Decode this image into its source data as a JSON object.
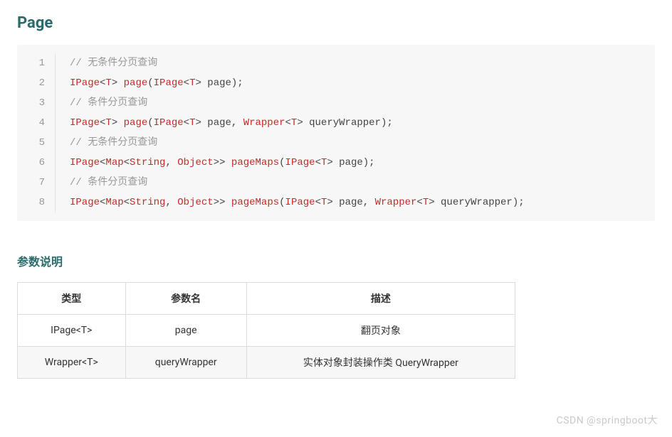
{
  "heading": "Page",
  "code": {
    "lines": [
      {
        "n": "1",
        "tokens": [
          {
            "t": "// 无条件分页查询",
            "c": "tok-comment"
          }
        ]
      },
      {
        "n": "2",
        "tokens": [
          {
            "t": "IPage",
            "c": "tok-type"
          },
          {
            "t": "<",
            "c": "tok-punc"
          },
          {
            "t": "T",
            "c": "tok-type"
          },
          {
            "t": "> ",
            "c": "tok-punc"
          },
          {
            "t": "page",
            "c": "tok-method"
          },
          {
            "t": "(",
            "c": "tok-punc"
          },
          {
            "t": "IPage",
            "c": "tok-type"
          },
          {
            "t": "<",
            "c": "tok-punc"
          },
          {
            "t": "T",
            "c": "tok-type"
          },
          {
            "t": "> page);",
            "c": "tok-param"
          }
        ]
      },
      {
        "n": "3",
        "tokens": [
          {
            "t": "// 条件分页查询",
            "c": "tok-comment"
          }
        ]
      },
      {
        "n": "4",
        "tokens": [
          {
            "t": "IPage",
            "c": "tok-type"
          },
          {
            "t": "<",
            "c": "tok-punc"
          },
          {
            "t": "T",
            "c": "tok-type"
          },
          {
            "t": "> ",
            "c": "tok-punc"
          },
          {
            "t": "page",
            "c": "tok-method"
          },
          {
            "t": "(",
            "c": "tok-punc"
          },
          {
            "t": "IPage",
            "c": "tok-type"
          },
          {
            "t": "<",
            "c": "tok-punc"
          },
          {
            "t": "T",
            "c": "tok-type"
          },
          {
            "t": "> page, ",
            "c": "tok-param"
          },
          {
            "t": "Wrapper",
            "c": "tok-type"
          },
          {
            "t": "<",
            "c": "tok-punc"
          },
          {
            "t": "T",
            "c": "tok-type"
          },
          {
            "t": "> queryWrapper);",
            "c": "tok-param"
          }
        ]
      },
      {
        "n": "5",
        "tokens": [
          {
            "t": "// 无条件分页查询",
            "c": "tok-comment"
          }
        ]
      },
      {
        "n": "6",
        "tokens": [
          {
            "t": "IPage",
            "c": "tok-type"
          },
          {
            "t": "<",
            "c": "tok-punc"
          },
          {
            "t": "Map",
            "c": "tok-type"
          },
          {
            "t": "<",
            "c": "tok-punc"
          },
          {
            "t": "String",
            "c": "tok-type"
          },
          {
            "t": ", ",
            "c": "tok-punc"
          },
          {
            "t": "Object",
            "c": "tok-type"
          },
          {
            "t": ">> ",
            "c": "tok-punc"
          },
          {
            "t": "pageMaps",
            "c": "tok-method"
          },
          {
            "t": "(",
            "c": "tok-punc"
          },
          {
            "t": "IPage",
            "c": "tok-type"
          },
          {
            "t": "<",
            "c": "tok-punc"
          },
          {
            "t": "T",
            "c": "tok-type"
          },
          {
            "t": "> page);",
            "c": "tok-param"
          }
        ]
      },
      {
        "n": "7",
        "tokens": [
          {
            "t": "// 条件分页查询",
            "c": "tok-comment"
          }
        ]
      },
      {
        "n": "8",
        "tokens": [
          {
            "t": "IPage",
            "c": "tok-type"
          },
          {
            "t": "<",
            "c": "tok-punc"
          },
          {
            "t": "Map",
            "c": "tok-type"
          },
          {
            "t": "<",
            "c": "tok-punc"
          },
          {
            "t": "String",
            "c": "tok-type"
          },
          {
            "t": ", ",
            "c": "tok-punc"
          },
          {
            "t": "Object",
            "c": "tok-type"
          },
          {
            "t": ">> ",
            "c": "tok-punc"
          },
          {
            "t": "pageMaps",
            "c": "tok-method"
          },
          {
            "t": "(",
            "c": "tok-punc"
          },
          {
            "t": "IPage",
            "c": "tok-type"
          },
          {
            "t": "<",
            "c": "tok-punc"
          },
          {
            "t": "T",
            "c": "tok-type"
          },
          {
            "t": "> page, ",
            "c": "tok-param"
          },
          {
            "t": "Wrapper",
            "c": "tok-type"
          },
          {
            "t": "<",
            "c": "tok-punc"
          },
          {
            "t": "T",
            "c": "tok-type"
          },
          {
            "t": "> queryWrapper);",
            "c": "tok-param"
          }
        ]
      }
    ]
  },
  "params_heading": "参数说明",
  "table": {
    "headers": [
      "类型",
      "参数名",
      "描述"
    ],
    "rows": [
      [
        "IPage<T>",
        "page",
        "翻页对象"
      ],
      [
        "Wrapper<T>",
        "queryWrapper",
        "实体对象封装操作类 QueryWrapper"
      ]
    ]
  },
  "watermark": "CSDN @springboot大"
}
